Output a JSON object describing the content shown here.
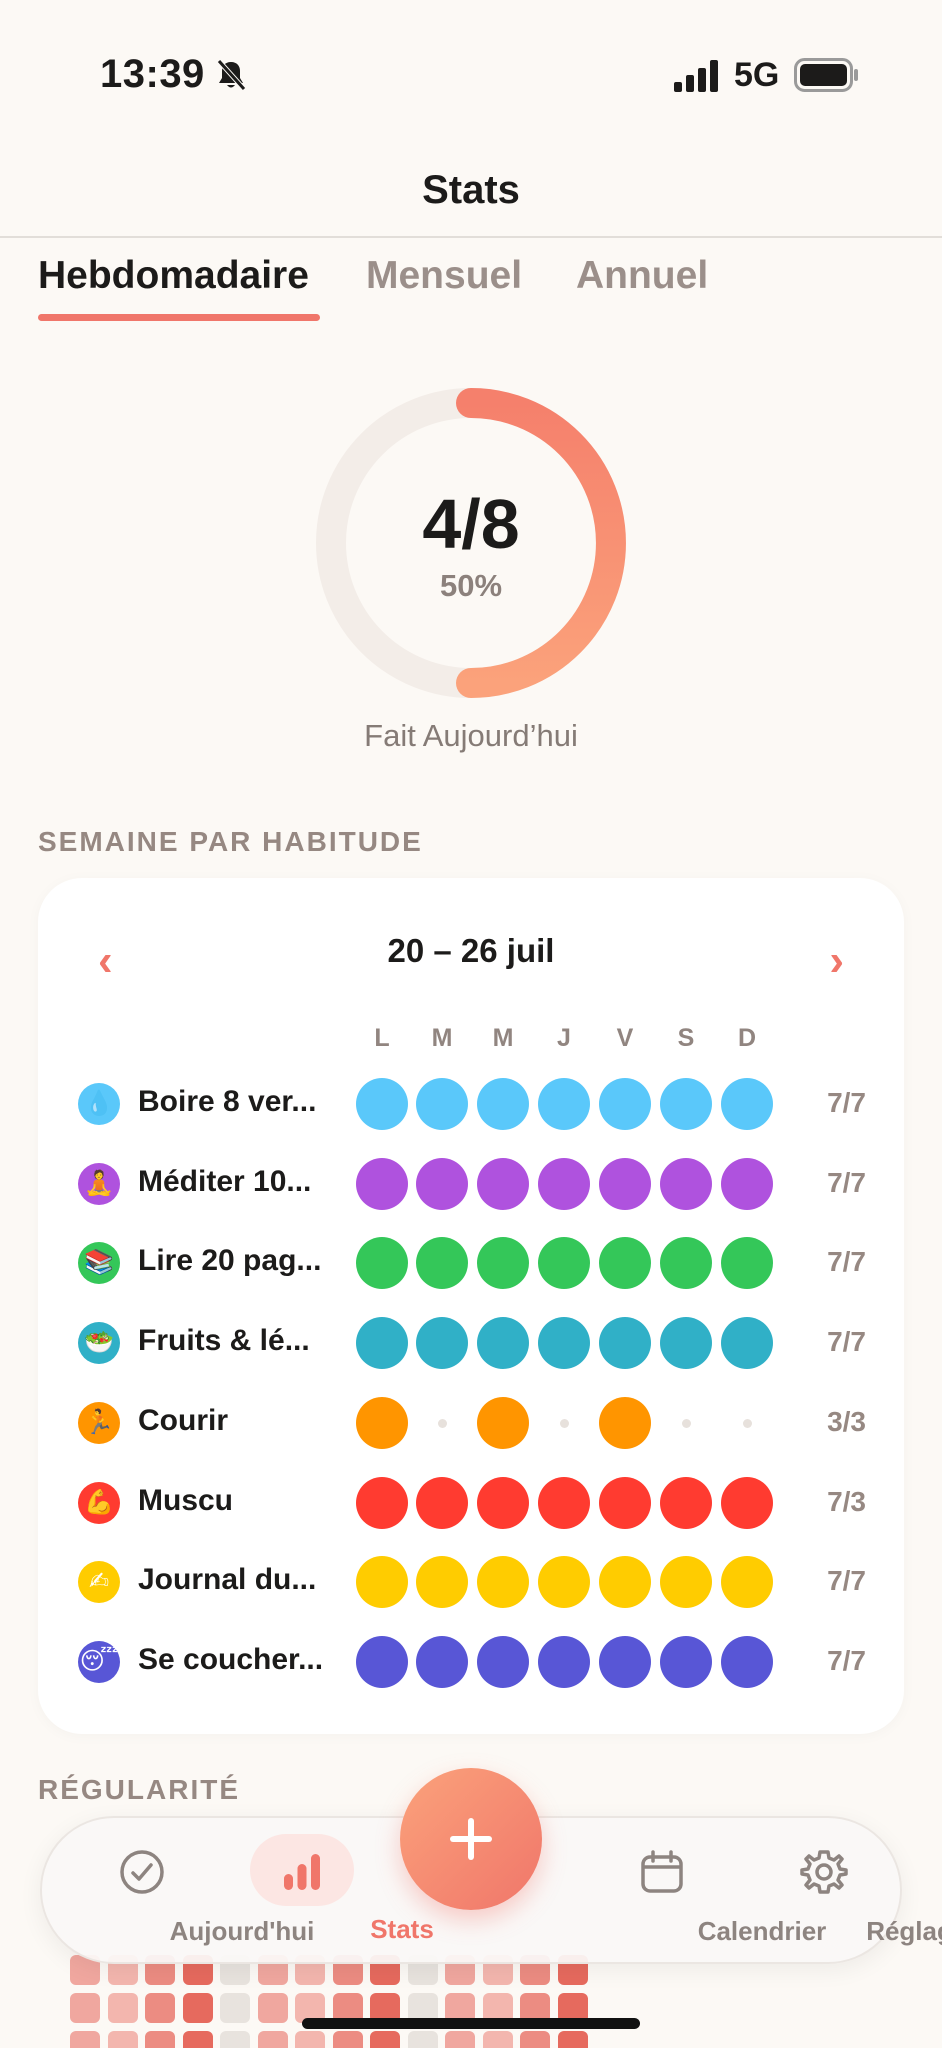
{
  "status_bar": {
    "time": "13:39",
    "network": "5G"
  },
  "header": {
    "title": "Stats"
  },
  "tabs": [
    {
      "label": "Hebdomadaire",
      "active": true
    },
    {
      "label": "Mensuel",
      "active": false
    },
    {
      "label": "Annuel",
      "active": false
    }
  ],
  "today": {
    "fraction": "4/8",
    "percent": "50%",
    "progress": 0.5,
    "caption": "Fait Aujourd’hui"
  },
  "weekly_section": {
    "label": "SEMAINE PAR HABITUDE"
  },
  "week": {
    "range": "20 – 26 juil",
    "prev": "‹",
    "next": "›",
    "days": [
      "L",
      "M",
      "M",
      "J",
      "V",
      "S",
      "D"
    ]
  },
  "habits": [
    {
      "icon": "water-drop-icon",
      "glyph": "💧",
      "name": "Boire 8 ver...",
      "count": "7/7",
      "color": "#5ac8fa",
      "done": [
        1,
        1,
        1,
        1,
        1,
        1,
        1
      ]
    },
    {
      "icon": "meditation-icon",
      "glyph": "🧘",
      "name": "Méditer 10...",
      "count": "7/7",
      "color": "#af52de",
      "done": [
        1,
        1,
        1,
        1,
        1,
        1,
        1
      ]
    },
    {
      "icon": "books-icon",
      "glyph": "📚",
      "name": "Lire 20 pag...",
      "count": "7/7",
      "color": "#34c759",
      "done": [
        1,
        1,
        1,
        1,
        1,
        1,
        1
      ]
    },
    {
      "icon": "salad-icon",
      "glyph": "🥗",
      "name": "Fruits & lé...",
      "count": "7/7",
      "color": "#30b0c7",
      "done": [
        1,
        1,
        1,
        1,
        1,
        1,
        1
      ]
    },
    {
      "icon": "runner-icon",
      "glyph": "🏃",
      "name": "Courir",
      "count": "3/3",
      "color": "#ff9500",
      "done": [
        1,
        0,
        1,
        0,
        1,
        0,
        0
      ]
    },
    {
      "icon": "biceps-icon",
      "glyph": "💪",
      "name": "Muscu",
      "count": "7/3",
      "color": "#ff3b30",
      "done": [
        1,
        1,
        1,
        1,
        1,
        1,
        1
      ]
    },
    {
      "icon": "writing-hand-icon",
      "glyph": "✍",
      "name": "Journal du...",
      "count": "7/7",
      "color": "#ffcc00",
      "done": [
        1,
        1,
        1,
        1,
        1,
        1,
        1
      ]
    },
    {
      "icon": "sleeping-face-icon",
      "glyph": "😴",
      "name": "Se coucher...",
      "count": "7/7",
      "color": "#5856d6",
      "done": [
        1,
        1,
        1,
        1,
        1,
        1,
        1
      ]
    }
  ],
  "regularity_section": {
    "label": "RÉGULARITÉ"
  },
  "tabbar": {
    "items": [
      {
        "label": "Aujourd'hui",
        "icon": "check-circle-icon",
        "active": false
      },
      {
        "label": "Stats",
        "icon": "bar-chart-icon",
        "active": true
      },
      {
        "label": "Calendrier",
        "icon": "calendar-icon",
        "active": false
      },
      {
        "label": "Réglages",
        "icon": "gear-icon",
        "active": false
      }
    ],
    "add_icon": "plus-icon"
  },
  "colors": {
    "accent": "#f0766a",
    "accent_light": "#fba27b",
    "ring_track": "#f3ede8",
    "background": "#fcf9f5"
  }
}
